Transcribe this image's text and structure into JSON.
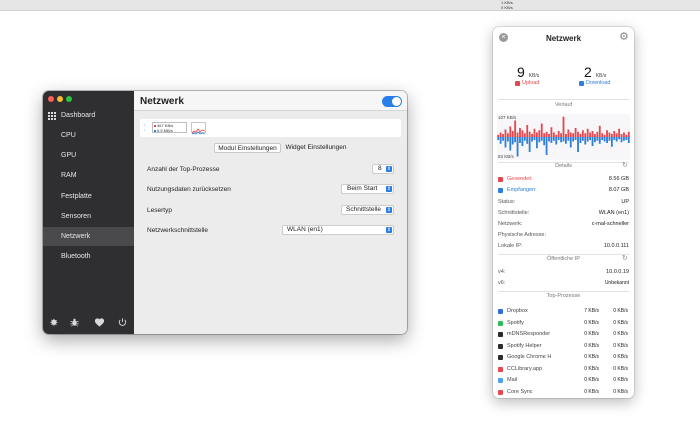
{
  "menubar": {
    "speed_up": "1 KB/s",
    "speed_down": "0 KB/s"
  },
  "settings": {
    "sidebar": [
      {
        "label": "Dashboard"
      },
      {
        "label": "CPU"
      },
      {
        "label": "GPU"
      },
      {
        "label": "RAM"
      },
      {
        "label": "Festplatte"
      },
      {
        "label": "Sensoren"
      },
      {
        "label": "Netzwerk"
      },
      {
        "label": "Bluetooth"
      }
    ],
    "title": "Netzwerk",
    "preview": {
      "line1": "467 KB/s",
      "line2": "6.5 MB/s"
    },
    "tabs": [
      "Modul Einstellungen",
      "Widget Einstellungen"
    ],
    "rows": [
      {
        "label": "Anzahl der Top-Prozesse",
        "value": "8"
      },
      {
        "label": "Nutzungsdaten zurücksetzen",
        "value": "Beim Start"
      },
      {
        "label": "Lesertyp",
        "value": "Schnittstelle"
      },
      {
        "label": "Netzwerkschnittstelle",
        "value": "WLAN (en1)"
      }
    ]
  },
  "popup": {
    "title": "Netzwerk",
    "upload": {
      "value": "9",
      "unit": "KB/s",
      "caption": "Upload",
      "color": "#e8464e"
    },
    "download": {
      "value": "2",
      "unit": "KB/s",
      "caption": "Download",
      "color": "#2f7fd8"
    },
    "section_verlauf": "Verlauf",
    "chart_top_label": "107 KB/s",
    "chart_bottom_label": "83 KB/s",
    "chart_data": {
      "type": "area",
      "series": [
        {
          "values": [
            3,
            6,
            4,
            10,
            5,
            14,
            8,
            22,
            6,
            12,
            9,
            5,
            16,
            7,
            4,
            11,
            6,
            9,
            18,
            5,
            7,
            4,
            13,
            6,
            3,
            8,
            5,
            27,
            4,
            10,
            6,
            5,
            12,
            7,
            4,
            9,
            5,
            11,
            6,
            8,
            4,
            7,
            15,
            5,
            3,
            9,
            6,
            4,
            8,
            5,
            11,
            4,
            6,
            3,
            7
          ]
        },
        {
          "values": [
            4,
            9,
            5,
            14,
            6,
            18,
            10,
            7,
            26,
            8,
            12,
            5,
            9,
            20,
            6,
            4,
            15,
            7,
            5,
            11,
            24,
            6,
            8,
            5,
            10,
            4,
            7,
            6,
            9,
            5,
            14,
            6,
            4,
            20,
            8,
            5,
            10,
            6,
            4,
            12,
            7,
            5,
            9,
            4,
            6,
            8,
            5,
            13,
            4,
            6,
            3,
            7,
            5,
            4,
            8
          ]
        }
      ]
    },
    "section_details": "Details",
    "details": [
      {
        "key": "Gesendet:",
        "value": "8.56 GB",
        "color": "#e8464e"
      },
      {
        "key": "Empfangen:",
        "value": "8.07 GB",
        "color": "#2f7fd8"
      },
      {
        "key": "Status:",
        "value": "UP"
      },
      {
        "key": "Schnittstelle:",
        "value": "WLAN (en1)"
      },
      {
        "key": "Netzwerk:",
        "value": "c-mal-schneller"
      },
      {
        "key": "Physische Adresse:",
        "value": ""
      },
      {
        "key": "Lokale IP:",
        "value": "10.0.0.111"
      }
    ],
    "section_public": "Öffentliche IP",
    "public_ip": [
      {
        "key": "v4:",
        "value": "10.0.0.19"
      },
      {
        "key": "v6:",
        "value": "Unbekannt"
      }
    ],
    "section_processes": "Top-Prozesse",
    "processes": [
      {
        "name": "Dropbox",
        "up": "7 KB/s",
        "down": "0 KB/s",
        "icon_color": "#2f6fdb"
      },
      {
        "name": "Spotify",
        "up": "0 KB/s",
        "down": "0 KB/s",
        "icon_color": "#2ebd59"
      },
      {
        "name": "mDNSResponder",
        "up": "0 KB/s",
        "down": "0 KB/s",
        "icon_color": "#2a2a2a"
      },
      {
        "name": "Spotify Helper",
        "up": "0 KB/s",
        "down": "0 KB/s",
        "icon_color": "#2a2a2a"
      },
      {
        "name": "Google Chrome H",
        "up": "0 KB/s",
        "down": "0 KB/s",
        "icon_color": "#2a2a2a"
      },
      {
        "name": "CCLibrary.app",
        "up": "0 KB/s",
        "down": "0 KB/s",
        "icon_color": "#e9484e"
      },
      {
        "name": "Mail",
        "up": "0 KB/s",
        "down": "0 KB/s",
        "icon_color": "#4da3f0"
      },
      {
        "name": "Core Sync",
        "up": "0 KB/s",
        "down": "0 KB/s",
        "icon_color": "#e9484e"
      }
    ]
  }
}
